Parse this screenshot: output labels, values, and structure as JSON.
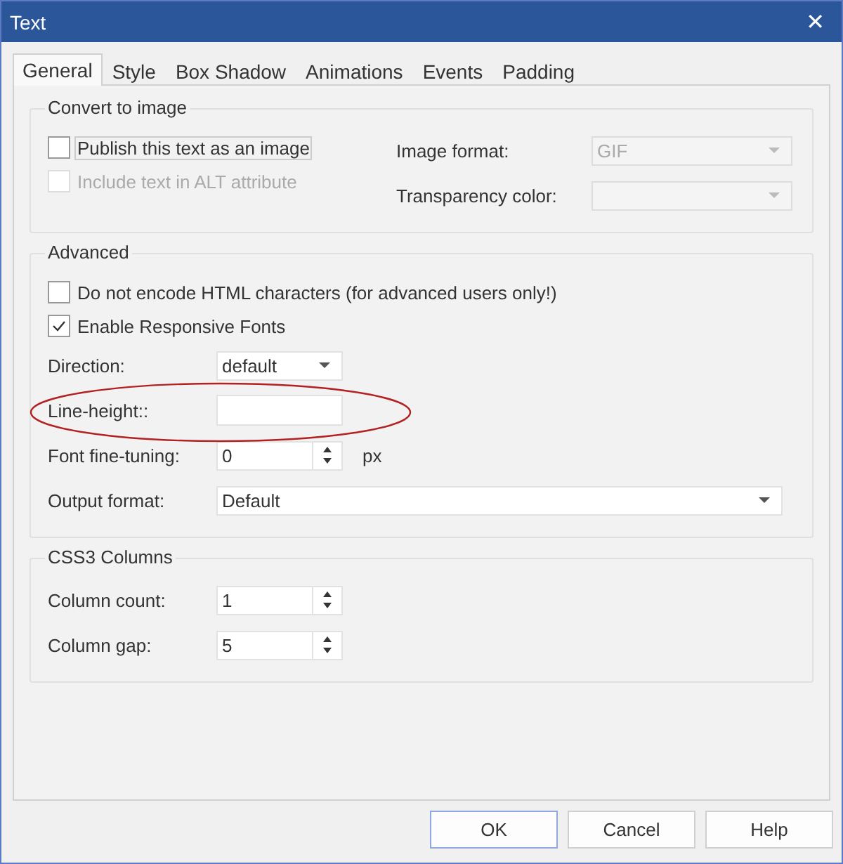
{
  "window": {
    "title": "Text",
    "close_glyph": "✕"
  },
  "tabs": [
    {
      "label": "General",
      "selected": true
    },
    {
      "label": "Style",
      "selected": false
    },
    {
      "label": "Box Shadow",
      "selected": false
    },
    {
      "label": "Animations",
      "selected": false
    },
    {
      "label": "Events",
      "selected": false
    },
    {
      "label": "Padding",
      "selected": false
    }
  ],
  "convert_to_image": {
    "title": "Convert to image",
    "checkboxes": [
      {
        "label": "Publish this text as an image",
        "checked": false,
        "disabled": false,
        "focused": true
      },
      {
        "label": "Include text in ALT attribute",
        "checked": false,
        "disabled": true,
        "focused": false
      }
    ],
    "fields": [
      {
        "kind": "dropdown",
        "label": "Image format:",
        "value": "GIF",
        "disabled": true
      },
      {
        "kind": "dropdown",
        "label": "Transparency color:",
        "disabled": true
      }
    ]
  },
  "advanced": {
    "title": "Advanced",
    "checkboxes": [
      {
        "label": "Do not encode HTML characters (for advanced users only!)",
        "checked": false,
        "disabled": false,
        "focused": false
      },
      {
        "label": "Enable Responsive Fonts",
        "checked": true,
        "disabled": false,
        "focused": false
      }
    ],
    "fields": [
      {
        "kind": "dropdown",
        "label": "Direction:",
        "value": "default",
        "disabled": false
      },
      {
        "kind": "text",
        "label": "Line-height::"
      },
      {
        "kind": "spin",
        "label": "Font fine-tuning:",
        "value": "0",
        "unit": "px"
      },
      {
        "kind": "wide-dropdown",
        "label": "Output format:",
        "value": "Default",
        "disabled": false
      }
    ]
  },
  "css3_columns": {
    "title": "CSS3 Columns",
    "fields": [
      {
        "kind": "spin",
        "label": "Column count:",
        "value": "1"
      },
      {
        "kind": "spin",
        "label": "Column gap:",
        "value": "5"
      }
    ]
  },
  "buttons": [
    {
      "label": "OK",
      "default": true
    },
    {
      "label": "Cancel",
      "default": false
    },
    {
      "label": "Help",
      "default": false
    }
  ]
}
